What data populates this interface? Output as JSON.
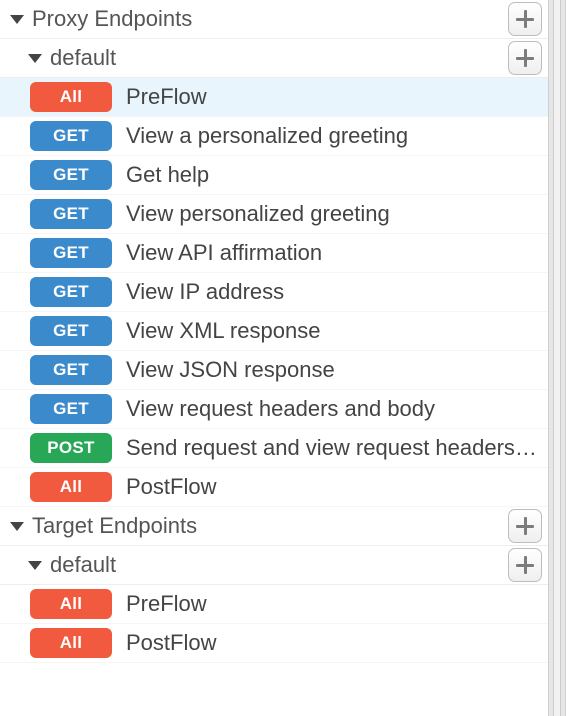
{
  "methodClass": {
    "All": "m-all",
    "GET": "m-get",
    "POST": "m-post"
  },
  "proxy": {
    "sectionTitle": "Proxy Endpoints",
    "groupTitle": "default",
    "flows": [
      {
        "method": "All",
        "label": "PreFlow",
        "selected": true
      },
      {
        "method": "GET",
        "label": "View a personalized greeting"
      },
      {
        "method": "GET",
        "label": "Get help"
      },
      {
        "method": "GET",
        "label": "View personalized greeting"
      },
      {
        "method": "GET",
        "label": "View API affirmation"
      },
      {
        "method": "GET",
        "label": "View IP address"
      },
      {
        "method": "GET",
        "label": "View XML response"
      },
      {
        "method": "GET",
        "label": "View JSON response"
      },
      {
        "method": "GET",
        "label": "View request headers and body"
      },
      {
        "method": "POST",
        "label": "Send request and view request headers and body"
      },
      {
        "method": "All",
        "label": "PostFlow"
      }
    ]
  },
  "target": {
    "sectionTitle": "Target Endpoints",
    "groupTitle": "default",
    "flows": [
      {
        "method": "All",
        "label": "PreFlow"
      },
      {
        "method": "All",
        "label": "PostFlow"
      }
    ]
  }
}
